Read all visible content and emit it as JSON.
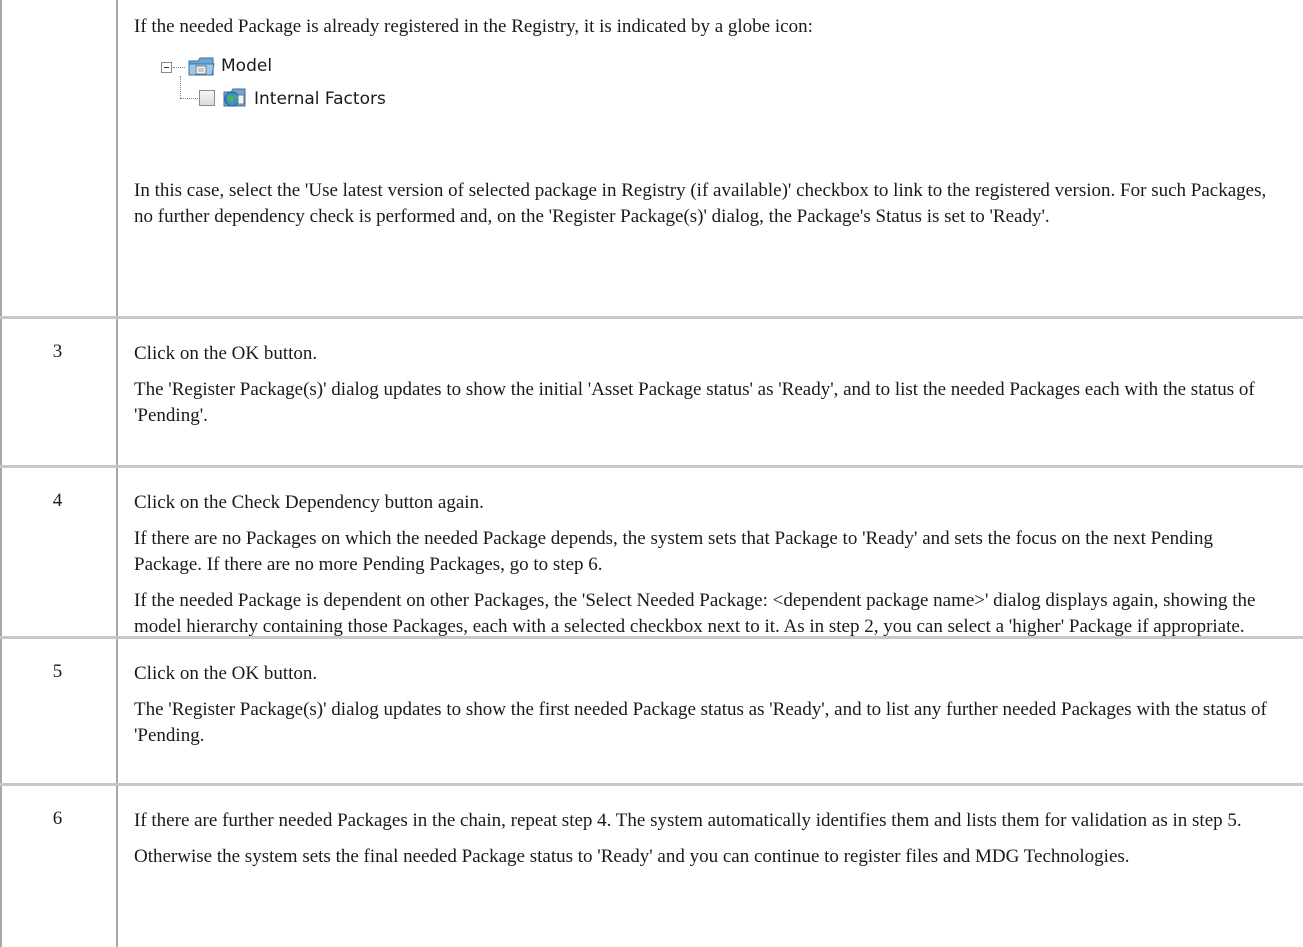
{
  "intro": {
    "text": "If the needed Package is already registered in the Registry, it is indicated by a globe icon:",
    "tree": {
      "root_label": "Model",
      "child_label": "Internal Factors",
      "icons": [
        "package-folder-icon",
        "globe-package-icon"
      ]
    },
    "followup": "In this case, select the 'Use latest version of selected package in Registry (if available)' checkbox to link to the registered version. For such Packages, no further dependency check is performed and, on the 'Register Package(s)' dialog, the Package's Status is set to 'Ready'."
  },
  "steps": [
    {
      "number": "3",
      "paragraphs": [
        "Click on the OK button.",
        "The 'Register Package(s)' dialog updates to show the initial 'Asset Package status' as 'Ready', and to list the needed Packages each with the status of 'Pending'."
      ]
    },
    {
      "number": "4",
      "paragraphs": [
        "Click on the Check Dependency button again.",
        "If there are no Packages on which the needed Package depends, the system sets that Package to 'Ready' and sets the focus on the next Pending Package. If there are no more Pending Packages, go to step 6.",
        "If the needed Package is dependent on other Packages, the 'Select Needed Package: <dependent package name>' dialog displays again, showing the model hierarchy containing those Packages, each with a selected checkbox next to it. As in step 2, you can select a 'higher' Package if appropriate."
      ]
    },
    {
      "number": "5",
      "paragraphs": [
        "Click on the OK button.",
        "The 'Register Package(s)' dialog updates to show the first needed Package status as 'Ready', and to list any further needed Packages with the status of 'Pending."
      ]
    },
    {
      "number": "6",
      "paragraphs": [
        "If there are further needed Packages in the chain, repeat step 4. The system automatically identifies them and lists them for validation as in step 5.",
        "Otherwise the system sets the final needed Package status to 'Ready' and you can continue to register files and MDG Technologies."
      ]
    }
  ],
  "colors": {
    "rule": "#c8c8c8",
    "column_rule": "#a8a8a8",
    "text": "#1a1a1a"
  }
}
